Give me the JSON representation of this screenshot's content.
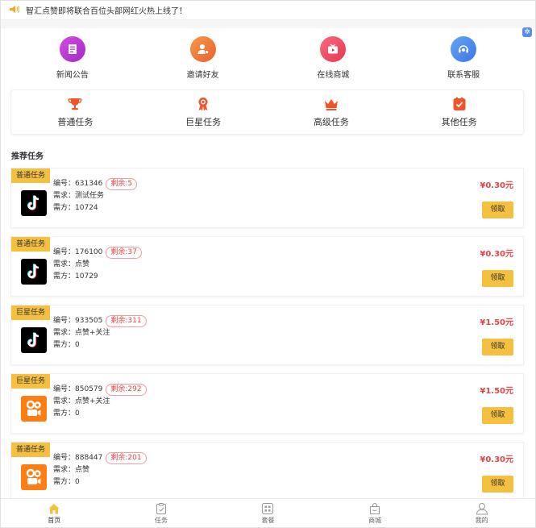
{
  "notice": {
    "text": "智汇点赞即将联合百位头部网红火热上线了！"
  },
  "quick_nav": [
    {
      "label": "新闻公告",
      "icon": "news-icon",
      "color": "#c03ad6"
    },
    {
      "label": "邀请好友",
      "icon": "invite-icon",
      "color": "#f07a3a"
    },
    {
      "label": "在线商城",
      "icon": "shop-tv-icon",
      "color": "#f04a63"
    },
    {
      "label": "联系客服",
      "icon": "service-icon",
      "color": "#4a8cf0"
    }
  ],
  "tiers": [
    {
      "label": "普通任务",
      "icon": "trophy-icon"
    },
    {
      "label": "巨星任务",
      "icon": "medal-icon"
    },
    {
      "label": "高级任务",
      "icon": "crown-icon"
    },
    {
      "label": "其他任务",
      "icon": "clipboard-icon"
    }
  ],
  "section_title": "推荐任务",
  "tasks": [
    {
      "tag": "普通任务",
      "id_label": "编号：",
      "id": "631346",
      "remain": "剩余:5",
      "req_label": "需求：",
      "req": "测试任务",
      "owner_label": "需方：",
      "owner": "10724",
      "price": "¥0.30元",
      "button": "领取",
      "platform": "tiktok"
    },
    {
      "tag": "普通任务",
      "id_label": "编号：",
      "id": "176100",
      "remain": "剩余:37",
      "req_label": "需求：",
      "req": "点赞",
      "owner_label": "需方：",
      "owner": "10729",
      "price": "¥0.30元",
      "button": "领取",
      "platform": "tiktok"
    },
    {
      "tag": "巨星任务",
      "id_label": "编号：",
      "id": "933505",
      "remain": "剩余:311",
      "req_label": "需求：",
      "req": "点赞+关注",
      "owner_label": "需方：",
      "owner": "0",
      "price": "¥1.50元",
      "button": "领取",
      "platform": "tiktok"
    },
    {
      "tag": "巨星任务",
      "id_label": "编号：",
      "id": "850579",
      "remain": "剩余:292",
      "req_label": "需求：",
      "req": "点赞+关注",
      "owner_label": "需方：",
      "owner": "0",
      "price": "¥1.50元",
      "button": "领取",
      "platform": "kuaishou"
    },
    {
      "tag": "普通任务",
      "id_label": "编号：",
      "id": "888447",
      "remain": "剩余:201",
      "req_label": "需求：",
      "req": "点赞",
      "owner_label": "需方：",
      "owner": "0",
      "price": "¥0.30元",
      "button": "领取",
      "platform": "kuaishou"
    }
  ],
  "tabbar": [
    {
      "label": "首页",
      "icon": "home-icon",
      "active": true
    },
    {
      "label": "任务",
      "icon": "task-icon",
      "active": false
    },
    {
      "label": "套餐",
      "icon": "package-icon",
      "active": false
    },
    {
      "label": "商城",
      "icon": "mall-icon",
      "active": false
    },
    {
      "label": "我的",
      "icon": "user-icon",
      "active": false
    }
  ],
  "colors": {
    "accent": "#f5c040",
    "price": "#e04545",
    "tier_icon": "#f0552a"
  }
}
